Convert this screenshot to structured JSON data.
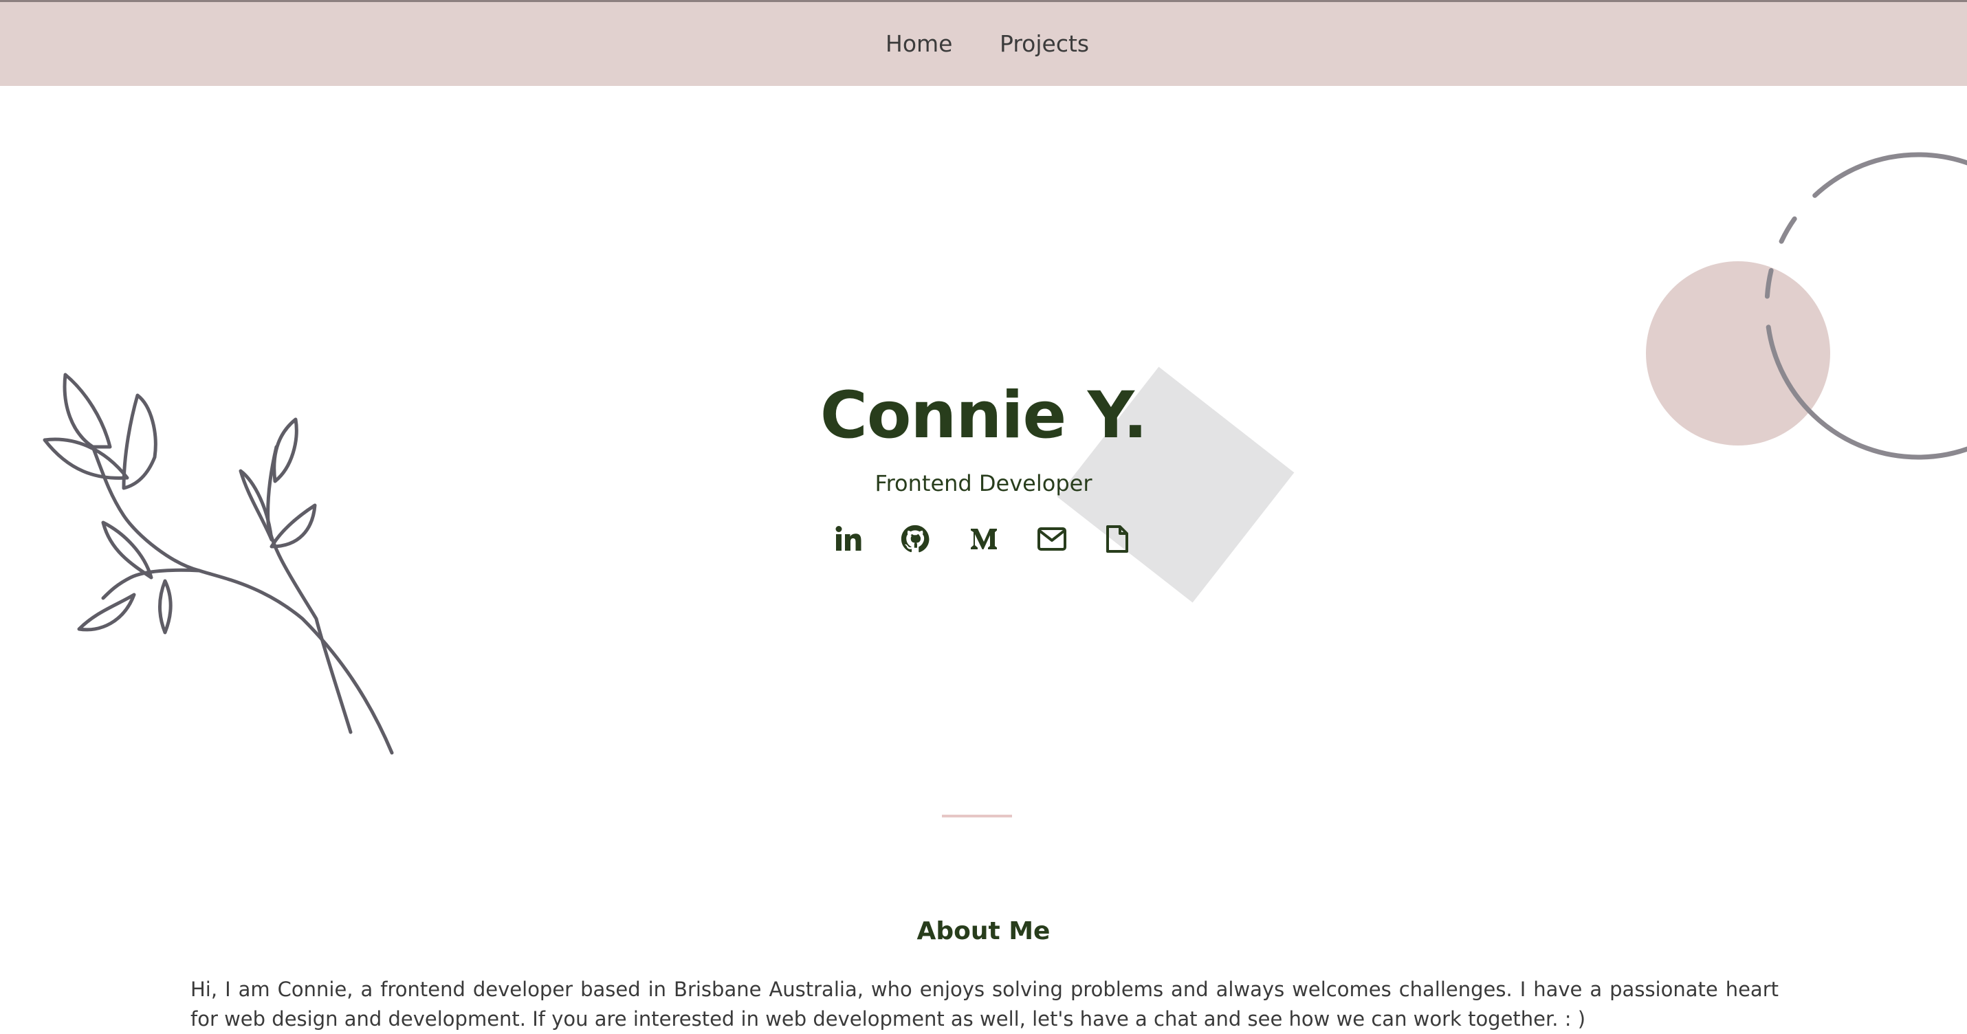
{
  "nav": {
    "links": [
      {
        "label": "Home"
      },
      {
        "label": "Projects"
      }
    ]
  },
  "hero": {
    "name": "Connie Y.",
    "role": "Frontend Developer",
    "social": [
      {
        "icon": "linkedin-icon"
      },
      {
        "icon": "github-icon"
      },
      {
        "icon": "medium-icon"
      },
      {
        "icon": "email-icon"
      },
      {
        "icon": "resume-document-icon"
      }
    ]
  },
  "about": {
    "title": "About Me",
    "text": "Hi, I am Connie, a frontend developer based in Brisbane Australia, who enjoys solving problems and always welcomes challenges. I have a passionate heart for web design and development. If you are interested in web development as well, let's have a chat and see how we can work together. : )"
  },
  "colors": {
    "nav_background": "#e1d1cf",
    "heading_green": "#283d1c",
    "accent_pink": "#e1cfcd",
    "divider_pink": "#e6c7c6",
    "decor_gray": "#e3e3e4"
  }
}
